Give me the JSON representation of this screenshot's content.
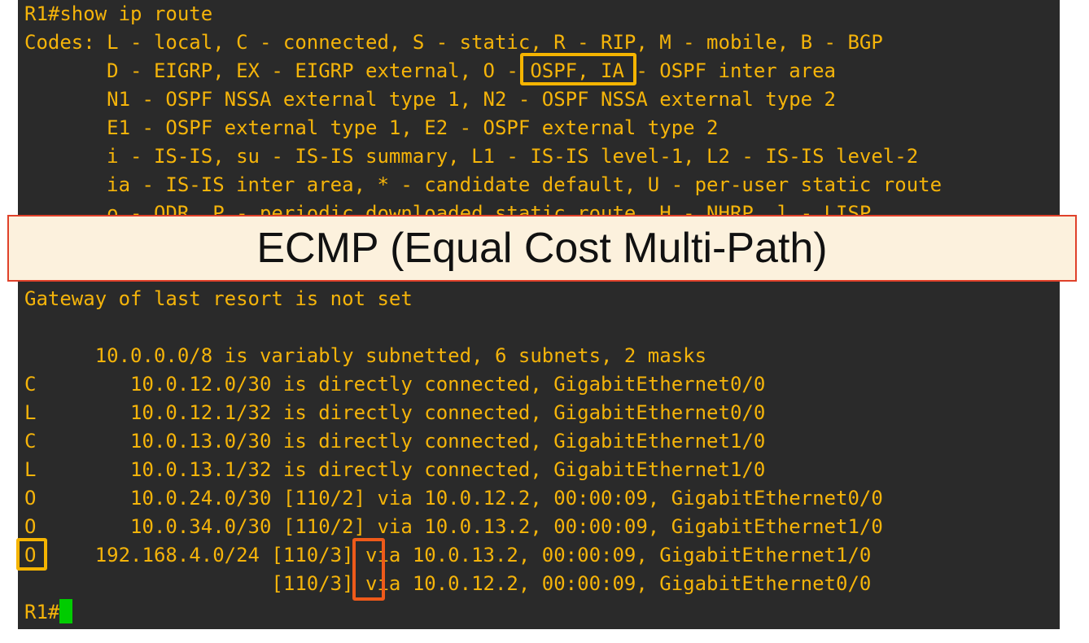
{
  "terminal": {
    "lines": [
      "R1#show ip route",
      "Codes: L - local, C - connected, S - static, R - RIP, M - mobile, B - BGP",
      "       D - EIGRP, EX - EIGRP external, O - OSPF, IA - OSPF inter area",
      "       N1 - OSPF NSSA external type 1, N2 - OSPF NSSA external type 2",
      "       E1 - OSPF external type 1, E2 - OSPF external type 2",
      "       i - IS-IS, su - IS-IS summary, L1 - IS-IS level-1, L2 - IS-IS level-2",
      "       ia - IS-IS inter area, * - candidate default, U - per-user static route",
      "       o - ODR, P - periodic downloaded static route, H - NHRP, l - LISP",
      "",
      "",
      "Gateway of last resort is not set",
      "",
      "      10.0.0.0/8 is variably subnetted, 6 subnets, 2 masks",
      "C        10.0.12.0/30 is directly connected, GigabitEthernet0/0",
      "L        10.0.12.1/32 is directly connected, GigabitEthernet0/0",
      "C        10.0.13.0/30 is directly connected, GigabitEthernet1/0",
      "L        10.0.13.1/32 is directly connected, GigabitEthernet1/0",
      "O        10.0.24.0/30 [110/2] via 10.0.12.2, 00:00:09, GigabitEthernet0/0",
      "O        10.0.34.0/30 [110/2] via 10.0.13.2, 00:00:09, GigabitEthernet1/0",
      "O     192.168.4.0/24 [110/3] via 10.0.13.2, 00:00:09, GigabitEthernet1/0",
      "                     [110/3] via 10.0.12.2, 00:00:09, GigabitEthernet0/0"
    ],
    "prompt": "R1#",
    "cursor_color": "#00cc00"
  },
  "banner": {
    "title": "ECMP (Equal Cost Multi-Path)"
  },
  "colors": {
    "terminal_bg": "#2a2a2a",
    "terminal_text": "#f5b40a",
    "highlight_yellow": "#f5b400",
    "highlight_orange": "#ef5a1a",
    "banner_bg": "#fcf1dd",
    "banner_border": "#e0412a"
  }
}
